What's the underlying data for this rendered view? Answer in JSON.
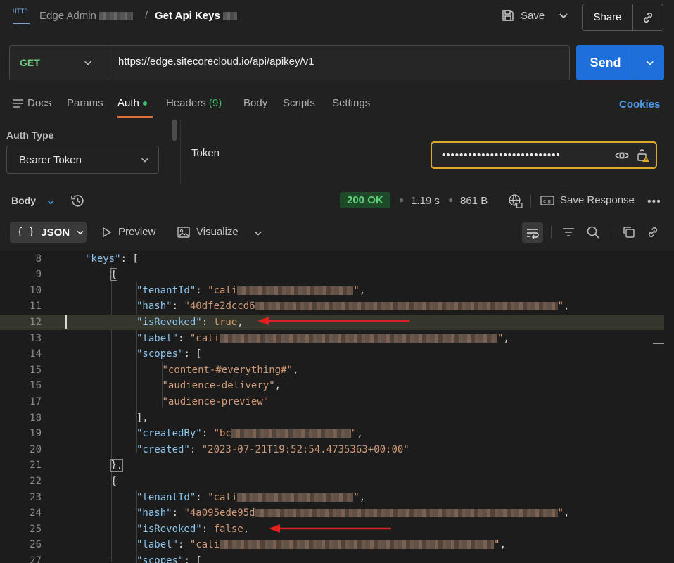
{
  "header": {
    "breadcrumb_parent": "Edge Admin",
    "separator": "/",
    "title": "Get Api Keys",
    "save_label": "Save",
    "share_label": "Share"
  },
  "request": {
    "method": "GET",
    "url": "https://edge.sitecorecloud.io/api/apikey/v1",
    "send_label": "Send"
  },
  "tabs": {
    "docs": "Docs",
    "params": "Params",
    "auth": "Auth",
    "headers": "Headers",
    "headers_count": "(9)",
    "body": "Body",
    "scripts": "Scripts",
    "settings": "Settings",
    "cookies": "Cookies"
  },
  "auth": {
    "type_label": "Auth Type",
    "type_value": "Bearer Token",
    "token_label": "Token",
    "token_masked": "•••••••••••••••••••••••••••"
  },
  "response": {
    "body_label": "Body",
    "status": "200 OK",
    "time": "1.19 s",
    "size": "861 B",
    "save_response": "Save Response",
    "view_mode": "JSON",
    "preview": "Preview",
    "visualize": "Visualize"
  },
  "code_lines": [
    {
      "n": "8",
      "indent": 0,
      "parts": [
        [
          "key",
          "\"keys\""
        ],
        [
          "pun",
          ": ["
        ]
      ]
    },
    {
      "n": "9",
      "indent": 1,
      "parts": [
        [
          "pun",
          "{"
        ]
      ]
    },
    {
      "n": "10",
      "indent": 2,
      "parts": [
        [
          "key",
          "\"tenantId\""
        ],
        [
          "pun",
          ": "
        ],
        [
          "str",
          "\"cali"
        ],
        [
          "redact",
          ""
        ],
        [
          "str",
          "\""
        ],
        [
          "pun",
          ","
        ]
      ]
    },
    {
      "n": "11",
      "indent": 2,
      "parts": [
        [
          "key",
          "\"hash\""
        ],
        [
          "pun",
          ": "
        ],
        [
          "str",
          "\"40dfe2dccd6"
        ],
        [
          "redact",
          ""
        ],
        [
          "str",
          "\""
        ],
        [
          "pun",
          ","
        ]
      ]
    },
    {
      "n": "12",
      "indent": 2,
      "parts": [
        [
          "key",
          "\"isRevoked\""
        ],
        [
          "pun",
          ": "
        ],
        [
          "lit",
          "true"
        ],
        [
          "pun",
          ","
        ]
      ]
    },
    {
      "n": "13",
      "indent": 2,
      "parts": [
        [
          "key",
          "\"label\""
        ],
        [
          "pun",
          ": "
        ],
        [
          "str",
          "\"cali"
        ],
        [
          "redact",
          ""
        ],
        [
          "str",
          "\""
        ],
        [
          "pun",
          ","
        ]
      ]
    },
    {
      "n": "14",
      "indent": 2,
      "parts": [
        [
          "key",
          "\"scopes\""
        ],
        [
          "pun",
          ": ["
        ]
      ]
    },
    {
      "n": "15",
      "indent": 3,
      "parts": [
        [
          "str",
          "\"content-#everything#\""
        ],
        [
          "pun",
          ","
        ]
      ]
    },
    {
      "n": "16",
      "indent": 3,
      "parts": [
        [
          "str",
          "\"audience-delivery\""
        ],
        [
          "pun",
          ","
        ]
      ]
    },
    {
      "n": "17",
      "indent": 3,
      "parts": [
        [
          "str",
          "\"audience-preview\""
        ]
      ]
    },
    {
      "n": "18",
      "indent": 2,
      "parts": [
        [
          "pun",
          "],"
        ]
      ]
    },
    {
      "n": "19",
      "indent": 2,
      "parts": [
        [
          "key",
          "\"createdBy\""
        ],
        [
          "pun",
          ": "
        ],
        [
          "str",
          "\"bc"
        ],
        [
          "redact",
          ""
        ],
        [
          "str",
          "\""
        ],
        [
          "pun",
          ","
        ]
      ]
    },
    {
      "n": "20",
      "indent": 2,
      "parts": [
        [
          "key",
          "\"created\""
        ],
        [
          "pun",
          ": "
        ],
        [
          "str",
          "\"2023-07-21T19:52:54.4735363+00:00\""
        ]
      ]
    },
    {
      "n": "21",
      "indent": 1,
      "parts": [
        [
          "pun",
          "},"
        ]
      ]
    },
    {
      "n": "22",
      "indent": 1,
      "parts": [
        [
          "pun",
          "{"
        ]
      ]
    },
    {
      "n": "23",
      "indent": 2,
      "parts": [
        [
          "key",
          "\"tenantId\""
        ],
        [
          "pun",
          ": "
        ],
        [
          "str",
          "\"cali"
        ],
        [
          "redact",
          ""
        ],
        [
          "str",
          "\""
        ],
        [
          "pun",
          ","
        ]
      ]
    },
    {
      "n": "24",
      "indent": 2,
      "parts": [
        [
          "key",
          "\"hash\""
        ],
        [
          "pun",
          ": "
        ],
        [
          "str",
          "\"4a095ede95d"
        ],
        [
          "redact",
          ""
        ],
        [
          "str",
          "\""
        ],
        [
          "pun",
          ","
        ]
      ]
    },
    {
      "n": "25",
      "indent": 2,
      "parts": [
        [
          "key",
          "\"isRevoked\""
        ],
        [
          "pun",
          ": "
        ],
        [
          "lit",
          "false"
        ],
        [
          "pun",
          ","
        ]
      ]
    },
    {
      "n": "26",
      "indent": 2,
      "parts": [
        [
          "key",
          "\"label\""
        ],
        [
          "pun",
          ": "
        ],
        [
          "str",
          "\"cali"
        ],
        [
          "redact",
          ""
        ],
        [
          "str",
          "\""
        ],
        [
          "pun",
          ","
        ]
      ]
    },
    {
      "n": "27",
      "indent": 2,
      "parts": [
        [
          "key",
          "\"scopes\""
        ],
        [
          "pun",
          ": ["
        ]
      ]
    }
  ],
  "colors": {
    "accent_blue": "#1e6fd9",
    "get_green": "#6cc87a",
    "token_border": "#e0a92a",
    "annotation_red": "#e0201c"
  }
}
